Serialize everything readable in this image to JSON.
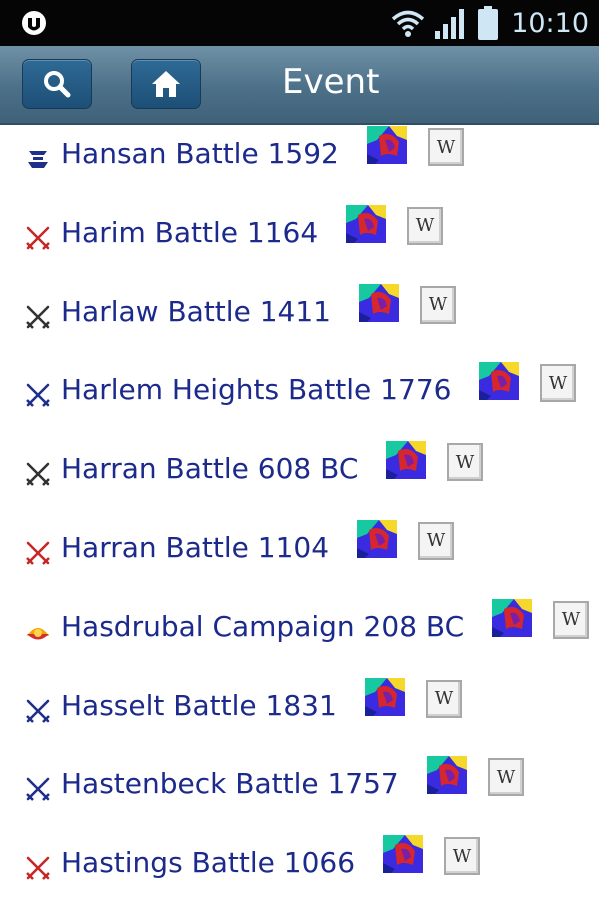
{
  "status_bar": {
    "time": "10:10",
    "icons": [
      "app-notification-icon",
      "wifi-icon",
      "signal-icon",
      "battery-icon"
    ]
  },
  "title_bar": {
    "title": "Event",
    "buttons": [
      "search-icon",
      "home-icon"
    ]
  },
  "colors": {
    "status_bar_bg": "#050505",
    "title_bar_bg": "#4c7088",
    "button_bg": "#1d4f76",
    "link_text": "#1c2a8c",
    "battle_blue": "#1f2f8c",
    "battle_red": "#c62828",
    "campaign_red": "#d32f2f"
  },
  "events": [
    {
      "label": "Hansan Battle 1592",
      "type_icon": "naval-battle-icon",
      "icon_color": "#1f2f8c",
      "map_icon": "map-icon",
      "wiki_label": "W"
    },
    {
      "label": "Harim Battle 1164",
      "type_icon": "crossed-swords-icon",
      "icon_color": "#c62828",
      "map_icon": "map-icon",
      "wiki_label": "W"
    },
    {
      "label": "Harlaw Battle 1411",
      "type_icon": "crossed-swords-icon",
      "icon_color": "#333333",
      "map_icon": "map-icon",
      "wiki_label": "W"
    },
    {
      "label": "Harlem Heights Battle 1776",
      "type_icon": "crossed-swords-icon",
      "icon_color": "#1f2f8c",
      "map_icon": "map-icon",
      "wiki_label": "W"
    },
    {
      "label": "Harran Battle 608 BC",
      "type_icon": "crossed-swords-icon",
      "icon_color": "#333333",
      "map_icon": "map-icon",
      "wiki_label": "W"
    },
    {
      "label": "Harran Battle 1104",
      "type_icon": "crossed-swords-icon",
      "icon_color": "#c62828",
      "map_icon": "map-icon",
      "wiki_label": "W"
    },
    {
      "label": "Hasdrubal Campaign 208 BC",
      "type_icon": "campaign-icon",
      "icon_color": "#d32f2f",
      "map_icon": "map-icon",
      "wiki_label": "W"
    },
    {
      "label": "Hasselt Battle 1831",
      "type_icon": "crossed-swords-icon",
      "icon_color": "#1f2f8c",
      "map_icon": "map-icon",
      "wiki_label": "W"
    },
    {
      "label": "Hastenbeck Battle 1757",
      "type_icon": "crossed-swords-icon",
      "icon_color": "#1f2f8c",
      "map_icon": "map-icon",
      "wiki_label": "W"
    },
    {
      "label": "Hastings Battle 1066",
      "type_icon": "crossed-swords-icon",
      "icon_color": "#c62828",
      "map_icon": "map-icon",
      "wiki_label": "W"
    }
  ]
}
